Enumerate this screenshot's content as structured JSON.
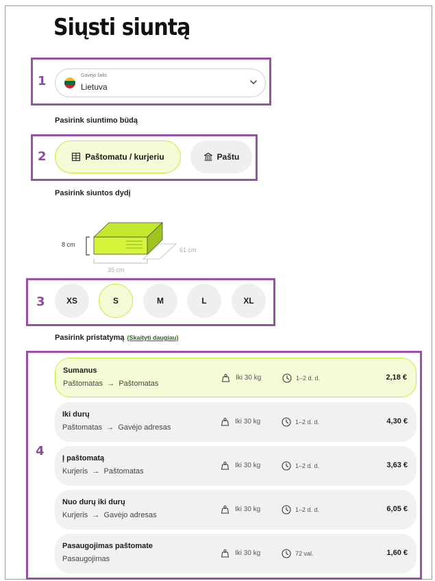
{
  "page": {
    "title": "Siųsti siuntą"
  },
  "markers": [
    "1",
    "2",
    "3",
    "4"
  ],
  "country": {
    "label": "Gavėjo šalis",
    "value": "Lietuva",
    "flag_colors": [
      "#fdb913",
      "#006a44",
      "#c1272d"
    ]
  },
  "shipping_method": {
    "label": "Pasirink siuntimo būdą",
    "options": [
      {
        "label": "Paštomatu / kurjeriu",
        "icon": "parcel-locker-icon",
        "selected": true
      },
      {
        "label": "Paštu",
        "icon": "post-office-icon",
        "selected": false
      }
    ]
  },
  "parcel_size": {
    "label": "Pasirink siuntos dydį",
    "dimensions": {
      "height": "8 cm",
      "depth": "61 cm",
      "width": "35 cm"
    },
    "sizes": [
      {
        "label": "XS",
        "selected": false
      },
      {
        "label": "S",
        "selected": true
      },
      {
        "label": "M",
        "selected": false
      },
      {
        "label": "L",
        "selected": false
      },
      {
        "label": "XL",
        "selected": false
      }
    ]
  },
  "delivery": {
    "label": "Pasirink pristatymą",
    "more_link": "(Skaityti daugiau)",
    "options": [
      {
        "name": "Sumanus",
        "from": "Paštomatas",
        "to": "Paštomatas",
        "weight": "Iki 30 kg",
        "time": "1–2 d. d.",
        "price": "2,18 €",
        "selected": true
      },
      {
        "name": "Iki durų",
        "from": "Paštomatas",
        "to": "Gavėjo adresas",
        "weight": "Iki 30 kg",
        "time": "1–2 d. d.",
        "price": "4,30 €",
        "selected": false
      },
      {
        "name": "Į paštomatą",
        "from": "Kurjeris",
        "to": "Paštomatas",
        "weight": "Iki 30 kg",
        "time": "1–2 d. d.",
        "price": "3,63 €",
        "selected": false
      },
      {
        "name": "Nuo durų iki durų",
        "from": "Kurjeris",
        "to": "Gavėjo adresas",
        "weight": "Iki 30 kg",
        "time": "1–2 d. d.",
        "price": "6,05 €",
        "selected": false
      },
      {
        "name": "Pasaugojimas paštomate",
        "from": "Pasaugojimas",
        "to": "",
        "weight": "Iki 30 kg",
        "time": "72 val.",
        "price": "1,60 €",
        "selected": false
      }
    ]
  },
  "colors": {
    "accent": "#c8ec3a",
    "accent_bg": "#f3fcd7",
    "annotation": "#9b4fa8"
  }
}
